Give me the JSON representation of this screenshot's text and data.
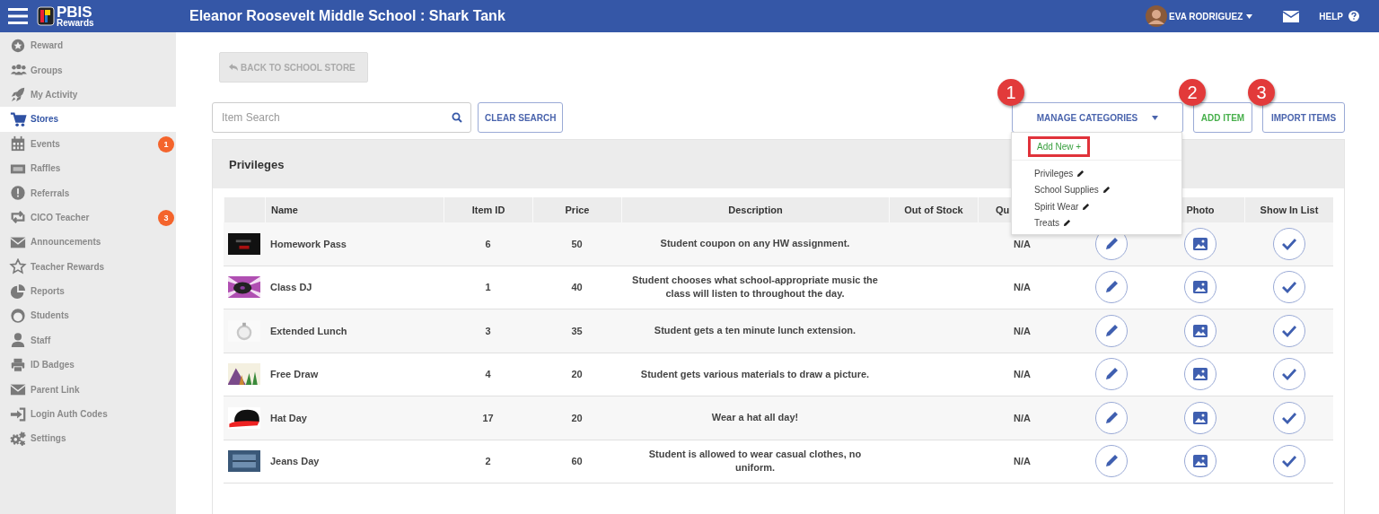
{
  "header": {
    "logo_top": "PBIS",
    "logo_bottom": "Rewards",
    "title": "Eleanor Roosevelt Middle School : Shark Tank",
    "user": "EVA RODRIGUEZ",
    "help": "HELP"
  },
  "sidebar": {
    "items": [
      {
        "label": "Reward",
        "selected": false
      },
      {
        "label": "Groups",
        "selected": false
      },
      {
        "label": "My Activity",
        "selected": false
      },
      {
        "label": "Stores",
        "selected": true
      },
      {
        "label": "Events",
        "selected": false,
        "badge": "1"
      },
      {
        "label": "Raffles",
        "selected": false
      },
      {
        "label": "Referrals",
        "selected": false
      },
      {
        "label": "CICO Teacher",
        "selected": false,
        "badge": "3"
      },
      {
        "label": "Announcements",
        "selected": false
      },
      {
        "label": "Teacher Rewards",
        "selected": false
      },
      {
        "label": "Reports",
        "selected": false
      },
      {
        "label": "Students",
        "selected": false
      },
      {
        "label": "Staff",
        "selected": false
      },
      {
        "label": "ID Badges",
        "selected": false
      },
      {
        "label": "Parent Link",
        "selected": false
      },
      {
        "label": "Login Auth Codes",
        "selected": false
      },
      {
        "label": "Settings",
        "selected": false
      }
    ]
  },
  "back_button": "BACK TO SCHOOL STORE",
  "search": {
    "placeholder": "Item Search"
  },
  "clear_search": "CLEAR SEARCH",
  "actions": [
    {
      "label": "MANAGE CATEGORIES",
      "kind": "dropdown",
      "callout": "1"
    },
    {
      "label": "ADD ITEM",
      "kind": "add",
      "callout": "2"
    },
    {
      "label": "IMPORT ITEMS",
      "kind": "import",
      "callout": "3"
    }
  ],
  "category_menu": {
    "add_new": "Add New +",
    "highlighted": true,
    "categories": [
      "Privileges",
      "School Supplies",
      "Spirit Wear",
      "Treats"
    ]
  },
  "panel": {
    "title": "Privileges",
    "columns": [
      "Name",
      "Item ID",
      "Price",
      "Description",
      "Out of Stock",
      "Qu",
      "Photo",
      "Show In List"
    ],
    "rows": [
      {
        "name": "Homework Pass",
        "item_id": "6",
        "price": "50",
        "description": "Student coupon on any HW assignment.",
        "quantity": "N/A",
        "shown": true
      },
      {
        "name": "Class DJ",
        "item_id": "1",
        "price": "40",
        "description": "Student chooses what school-appropriate music the class will listen to throughout the day.",
        "quantity": "N/A",
        "shown": true
      },
      {
        "name": "Extended Lunch",
        "item_id": "3",
        "price": "35",
        "description": "Student gets a ten minute lunch extension.",
        "quantity": "N/A",
        "shown": true
      },
      {
        "name": "Free Draw",
        "item_id": "4",
        "price": "20",
        "description": "Student gets various materials to draw a picture.",
        "quantity": "N/A",
        "shown": true
      },
      {
        "name": "Hat Day",
        "item_id": "17",
        "price": "20",
        "description": "Wear a hat all day!",
        "quantity": "N/A",
        "shown": true
      },
      {
        "name": "Jeans Day",
        "item_id": "2",
        "price": "60",
        "description": "Student is allowed to wear casual clothes, no uniform.",
        "quantity": "N/A",
        "shown": true
      }
    ]
  }
}
